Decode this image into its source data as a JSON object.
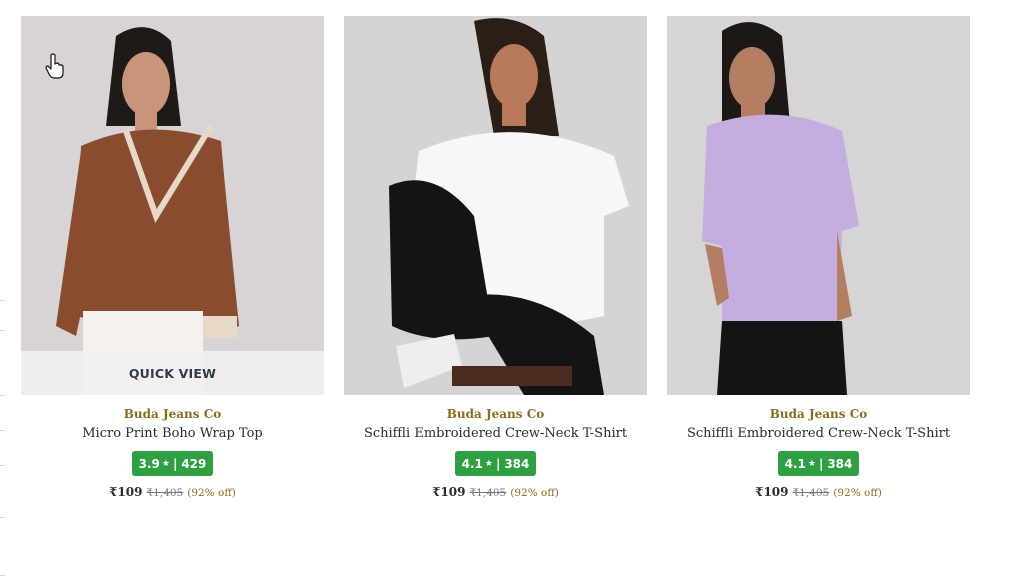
{
  "products": [
    {
      "brand": "Buda Jeans Co",
      "name": "Micro Print Boho Wrap Top",
      "rating": "3.9",
      "reviews": "429",
      "price": "₹109",
      "mrp": "₹1,405",
      "discount": "(92% off)",
      "quick_view": "QUICK VIEW",
      "garment_color": "#8a4c2e"
    },
    {
      "brand": "Buda Jeans Co",
      "name": "Schiffli Embroidered Crew-Neck T-Shirt",
      "rating": "4.1",
      "reviews": "384",
      "price": "₹109",
      "mrp": "₹1,405",
      "discount": "(92% off)",
      "garment_color": "#f7f7f7"
    },
    {
      "brand": "Buda Jeans Co",
      "name": "Schiffli Embroidered Crew-Neck T-Shirt",
      "rating": "4.1",
      "reviews": "384",
      "price": "₹109",
      "mrp": "₹1,405",
      "discount": "(92% off)",
      "garment_color": "#c4addf"
    }
  ],
  "rating_separator": "|",
  "colors": {
    "brand_text": "#8b6b1f",
    "rating_badge": "#2ea043",
    "image_bg": "#dcdad9"
  }
}
